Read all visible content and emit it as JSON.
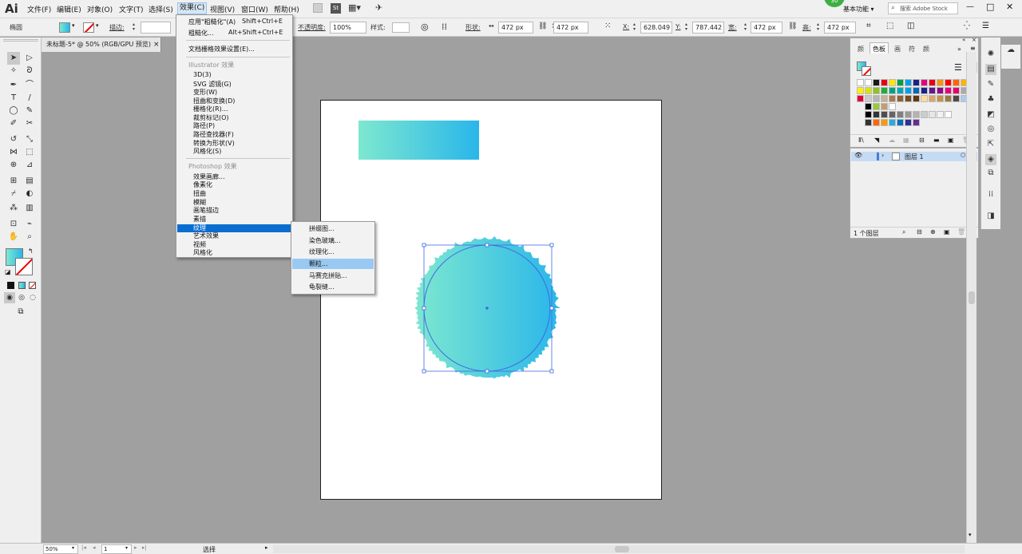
{
  "app": {
    "logo": "Ai",
    "colors": {
      "accent": "#0a6ed1",
      "gradient_start": "#7ee8d0",
      "gradient_end": "#29b6ea",
      "selection": "#4169e1"
    }
  },
  "menubar": {
    "items": [
      "文件(F)",
      "编辑(E)",
      "对象(O)",
      "文字(T)",
      "选择(S)",
      "效果(C)",
      "视图(V)",
      "窗口(W)",
      "帮助(H)"
    ],
    "workspace": "基本功能",
    "search_placeholder": "搜索 Adobe Stock",
    "badge": "30",
    "st_label": "St"
  },
  "controlbar": {
    "shape_label": "椭圆",
    "stroke_label": "描边:",
    "opacity_label": "不透明度:",
    "opacity_value": "100%",
    "style_label": "样式:",
    "shape_prop_label": "形状:",
    "shape_w": "472 px",
    "shape_h": "472 px",
    "x_label": "X:",
    "x_value": "628.049",
    "y_label": "Y:",
    "y_value": "787.442",
    "w_label": "宽:",
    "w_value": "472 px",
    "h_label": "高:",
    "h_value": "472 px"
  },
  "document_tab": {
    "title": "未标题-5* @ 50% (RGB/GPU 预览)",
    "close": "×"
  },
  "effect_menu": {
    "apply_last": "应用\"粗糙化\"(A)",
    "apply_last_shortcut": "Shift+Ctrl+E",
    "last": "粗糙化...",
    "last_shortcut": "Alt+Shift+Ctrl+E",
    "raster_settings": "文档栅格效果设置(E)...",
    "illustrator_header": "Illustrator 效果",
    "illustrator_items": [
      "3D(3)",
      "SVG 滤镜(G)",
      "变形(W)",
      "扭曲和变换(D)",
      "栅格化(R)...",
      "裁剪标记(O)",
      "路径(P)",
      "路径查找器(F)",
      "转换为形状(V)",
      "风格化(S)"
    ],
    "photoshop_header": "Photoshop 效果",
    "photoshop_items": [
      "效果画廊...",
      "像素化",
      "扭曲",
      "模糊",
      "画笔描边",
      "素描",
      "纹理",
      "艺术效果",
      "视频",
      "风格化"
    ]
  },
  "texture_menu": {
    "items": [
      "拼缀图...",
      "染色玻璃...",
      "纹理化...",
      "颗粒...",
      "马赛克拼贴...",
      "龟裂缝..."
    ],
    "highlighted": "颗粒..."
  },
  "swatches_panel": {
    "tabs": [
      "颜",
      "色板",
      "画",
      "符",
      "颜"
    ],
    "active_tab": "色板",
    "rows": [
      [
        "#ffffff",
        "#ffffff",
        "#1a1a1a",
        "#e6001a",
        "#ffe600",
        "#00a040",
        "#00a0e9",
        "#1d2088",
        "#e4007f",
        "#e60012",
        "#f39800",
        "#ff0000",
        "#ff6600",
        "#ffb400"
      ],
      [
        "#ffef00",
        "#d7e600",
        "#8fc31f",
        "#22ac38",
        "#00a381",
        "#00a7b5",
        "#00a0e9",
        "#0068b7",
        "#1d2088",
        "#601986",
        "#920783",
        "#e4007f",
        "#e5006a",
        "#aaaaaa"
      ],
      [
        "#e60033",
        "#c9caca",
        "#b5b5b6",
        "#c7b299",
        "#a67c52",
        "#8c6239",
        "#754c24",
        "#603813",
        "#ffdb9e",
        "#dea36b",
        "#c3924f",
        "#9b7a3d",
        "#534741",
        "#aaccee"
      ],
      [
        "#000000",
        "#99cc33",
        "#c69c6d",
        "#ffffff"
      ],
      [
        "#000000",
        "#333333",
        "#4d4d4d",
        "#666666",
        "#808080",
        "#999999",
        "#b3b3b3",
        "#cccccc",
        "#e6e6e6",
        "#f2f2f2",
        "#ffffff"
      ],
      [
        "#333333",
        "#ff6600",
        "#ff9900",
        "#29abe2",
        "#0071bc",
        "#2e3192",
        "#662d91"
      ]
    ]
  },
  "layers_panel": {
    "layer_name": "图层 1",
    "count": "1 个图层"
  },
  "statusbar": {
    "zoom": "50%",
    "artboard": "1",
    "mode": "选择"
  }
}
